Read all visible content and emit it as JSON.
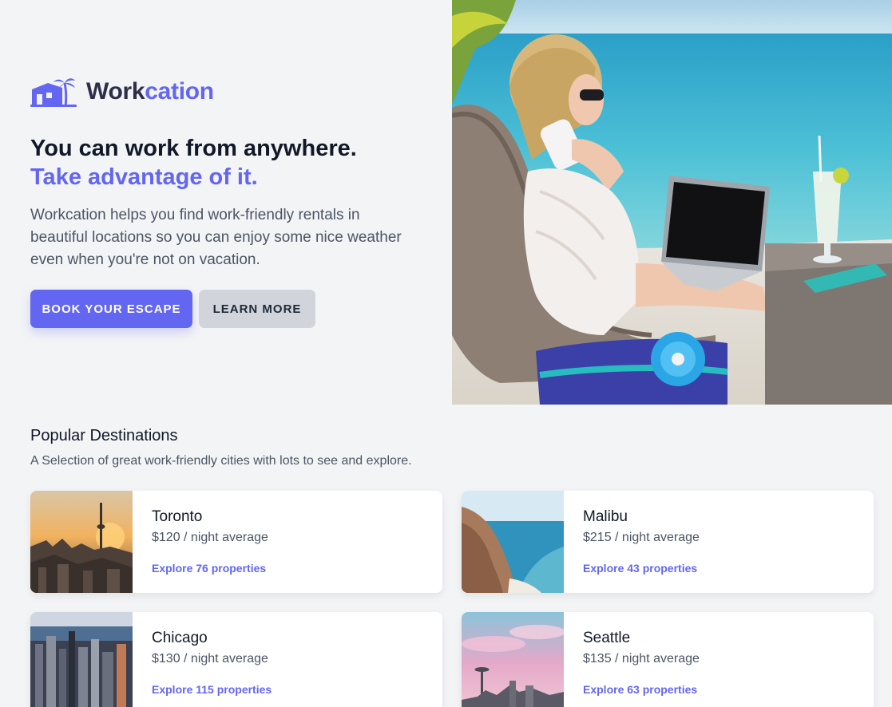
{
  "brand": {
    "name_part1": "Work",
    "name_part2": "cation",
    "accent_color": "#6366f1"
  },
  "hero": {
    "headline_line1": "You can work from anywhere.",
    "headline_line2": "Take advantage of it.",
    "description": "Workcation helps you find work-friendly rentals in beautiful locations so you can enjoy some nice weather even when you're not on vacation.",
    "primary_button": "BOOK YOUR ESCAPE",
    "secondary_button": "LEARN MORE"
  },
  "destinations": {
    "title": "Popular Destinations",
    "subtitle": "A Selection of great work-friendly cities with lots to see and explore.",
    "items": [
      {
        "city": "Toronto",
        "price": "$120 / night average",
        "link": "Explore 76 properties"
      },
      {
        "city": "Malibu",
        "price": "$215 / night average",
        "link": "Explore 43 properties"
      },
      {
        "city": "Chicago",
        "price": "$130 / night average",
        "link": "Explore 115 properties"
      },
      {
        "city": "Seattle",
        "price": "$135 / night average",
        "link": "Explore 63 properties"
      }
    ]
  }
}
